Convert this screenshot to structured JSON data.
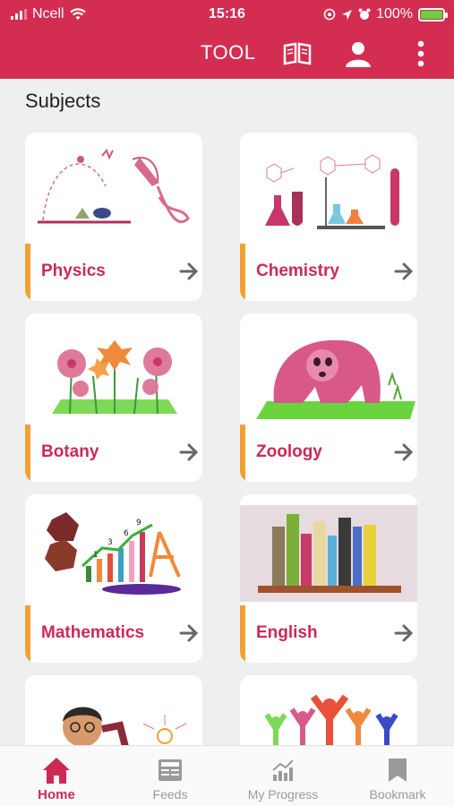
{
  "status_bar": {
    "carrier": "Ncell",
    "time": "15:16",
    "battery": "100%"
  },
  "app_bar": {
    "title": "TOOL",
    "icons": [
      "book-icon",
      "profile-icon",
      "more-vert-icon"
    ]
  },
  "section_title": "Subjects",
  "subjects": [
    {
      "label": "Physics"
    },
    {
      "label": "Chemistry"
    },
    {
      "label": "Botany"
    },
    {
      "label": "Zoology"
    },
    {
      "label": "Mathematics"
    },
    {
      "label": "English"
    },
    {
      "label": ""
    },
    {
      "label": ""
    }
  ],
  "bottom_nav": [
    {
      "label": "Home",
      "icon": "home-icon",
      "active": true
    },
    {
      "label": "Feeds",
      "icon": "feeds-icon",
      "active": false
    },
    {
      "label": "My Progress",
      "icon": "chart-icon",
      "active": false
    },
    {
      "label": "Bookmark",
      "icon": "bookmark-icon",
      "active": false
    }
  ],
  "colors": {
    "brand": "#d42d52",
    "label": "#cc2a55",
    "accent": "#f0a132"
  }
}
